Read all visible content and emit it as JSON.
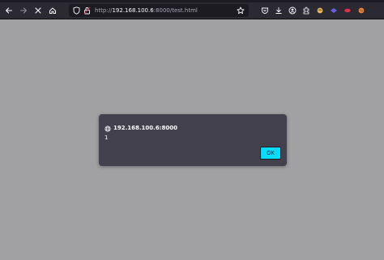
{
  "browser": {
    "url": {
      "prefix": "http://",
      "host": "192.168.100.6",
      "port": ":8000",
      "path": "/test.html"
    },
    "icons": {
      "back": "arrow-left-icon",
      "forward": "arrow-right-icon",
      "stop": "close-icon",
      "home": "home-icon",
      "tracking": "shield-icon",
      "permissions": "page-insecure-icon",
      "bookmark": "star-icon",
      "pocket": "pocket-icon",
      "downloads": "download-icon",
      "account": "account-icon",
      "extensions": "puzzle-icon",
      "extension_1": "extension-icon",
      "extension_2": "extension-icon",
      "extension_3": "extension-icon",
      "extension_4": "extension-icon"
    },
    "accent_colors": {
      "button": "#00ddff",
      "dialog_bg": "#42414d",
      "page_bg": "#a1a1a3"
    }
  },
  "dialog": {
    "origin": "192.168.100.6:8000",
    "message": "1",
    "ok_label": "OK"
  }
}
